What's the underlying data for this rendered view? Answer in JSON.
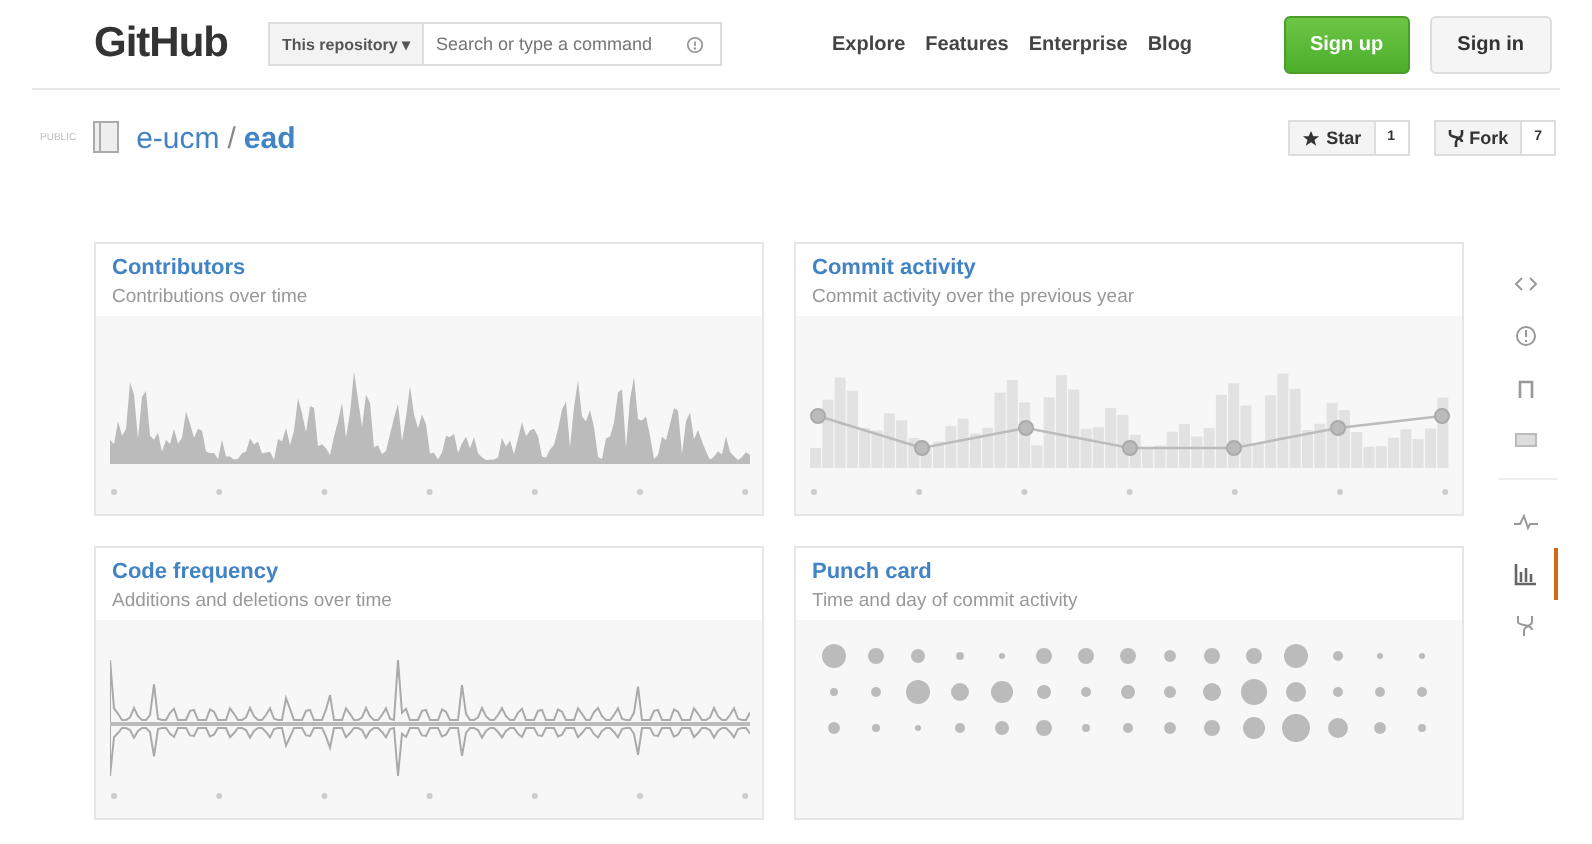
{
  "header": {
    "logo": "GitHub",
    "scope": "This repository",
    "scope_caret": "▾",
    "search_placeholder": "Search or type a command",
    "nav": [
      "Explore",
      "Features",
      "Enterprise",
      "Blog"
    ],
    "sign_up": "Sign up",
    "sign_in": "Sign in"
  },
  "repo": {
    "visibility": "PUBLIC",
    "owner": "e-ucm",
    "separator": "/",
    "name": "ead",
    "star": {
      "label": "Star",
      "count": "1"
    },
    "fork": {
      "label": "Fork",
      "count": "7"
    }
  },
  "graphs": [
    {
      "kind": "contributors",
      "title": "Contributors",
      "subtitle": "Contributions over time"
    },
    {
      "kind": "commits",
      "title": "Commit activity",
      "subtitle": "Commit activity over the previous year"
    },
    {
      "kind": "frequency",
      "title": "Code frequency",
      "subtitle": "Additions and deletions over time"
    },
    {
      "kind": "punch",
      "title": "Punch card",
      "subtitle": "Time and day of commit activity"
    }
  ],
  "sidebar": {
    "items": [
      {
        "kind": "code",
        "selected": false
      },
      {
        "kind": "issues",
        "selected": false
      },
      {
        "kind": "pulls",
        "selected": false
      },
      {
        "kind": "wiki",
        "selected": false
      },
      {
        "kind": "pulse",
        "selected": false
      },
      {
        "kind": "graphs",
        "selected": true
      },
      {
        "kind": "network",
        "selected": false
      }
    ]
  }
}
